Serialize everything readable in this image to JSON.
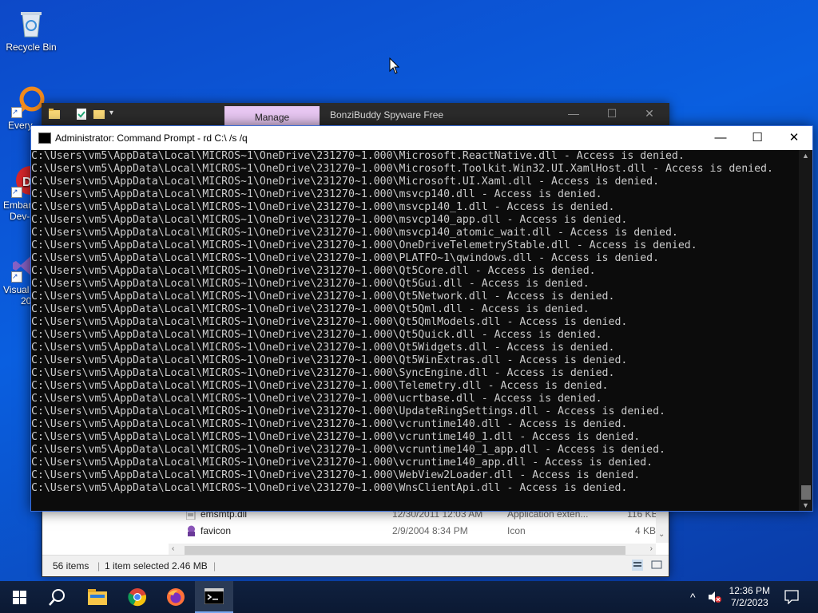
{
  "desktop": {
    "icons": [
      {
        "label": "Recycle Bin"
      },
      {
        "label": "Every"
      },
      {
        "label": "Embar"
      },
      {
        "label": "Dev-"
      },
      {
        "label": "Visual"
      },
      {
        "label": "20"
      }
    ]
  },
  "explorer": {
    "ribbon_tab": "Manage",
    "title": "BonziBuddy Spyware Free",
    "controls": {
      "minimize": "—",
      "maximize": "☐",
      "close": "✕"
    },
    "rows": [
      {
        "name": "emsmtp.dll",
        "date": "12/30/2011 12:03 AM",
        "type": "Application exten...",
        "size": "116 KB"
      },
      {
        "name": "favicon",
        "date": "2/9/2004 8:34 PM",
        "type": "Icon",
        "size": "4 KB"
      }
    ],
    "status": {
      "items": "56 items",
      "selected": "1 item selected  2.46 MB"
    }
  },
  "cmd": {
    "title": "Administrator: Command Prompt - rd  C:\\ /s /q",
    "controls": {
      "minimize": "—",
      "maximize": "☐",
      "close": "✕"
    },
    "lines": [
      "C:\\Users\\vm5\\AppData\\Local\\MICROS~1\\OneDrive\\231270~1.000\\Microsoft.ReactNative.dll - Access is denied.",
      "C:\\Users\\vm5\\AppData\\Local\\MICROS~1\\OneDrive\\231270~1.000\\Microsoft.Toolkit.Win32.UI.XamlHost.dll - Access is denied.",
      "C:\\Users\\vm5\\AppData\\Local\\MICROS~1\\OneDrive\\231270~1.000\\Microsoft.UI.Xaml.dll - Access is denied.",
      "C:\\Users\\vm5\\AppData\\Local\\MICROS~1\\OneDrive\\231270~1.000\\msvcp140.dll - Access is denied.",
      "C:\\Users\\vm5\\AppData\\Local\\MICROS~1\\OneDrive\\231270~1.000\\msvcp140_1.dll - Access is denied.",
      "C:\\Users\\vm5\\AppData\\Local\\MICROS~1\\OneDrive\\231270~1.000\\msvcp140_app.dll - Access is denied.",
      "C:\\Users\\vm5\\AppData\\Local\\MICROS~1\\OneDrive\\231270~1.000\\msvcp140_atomic_wait.dll - Access is denied.",
      "C:\\Users\\vm5\\AppData\\Local\\MICROS~1\\OneDrive\\231270~1.000\\OneDriveTelemetryStable.dll - Access is denied.",
      "C:\\Users\\vm5\\AppData\\Local\\MICROS~1\\OneDrive\\231270~1.000\\PLATFO~1\\qwindows.dll - Access is denied.",
      "C:\\Users\\vm5\\AppData\\Local\\MICROS~1\\OneDrive\\231270~1.000\\Qt5Core.dll - Access is denied.",
      "C:\\Users\\vm5\\AppData\\Local\\MICROS~1\\OneDrive\\231270~1.000\\Qt5Gui.dll - Access is denied.",
      "C:\\Users\\vm5\\AppData\\Local\\MICROS~1\\OneDrive\\231270~1.000\\Qt5Network.dll - Access is denied.",
      "C:\\Users\\vm5\\AppData\\Local\\MICROS~1\\OneDrive\\231270~1.000\\Qt5Qml.dll - Access is denied.",
      "C:\\Users\\vm5\\AppData\\Local\\MICROS~1\\OneDrive\\231270~1.000\\Qt5QmlModels.dll - Access is denied.",
      "C:\\Users\\vm5\\AppData\\Local\\MICROS~1\\OneDrive\\231270~1.000\\Qt5Quick.dll - Access is denied.",
      "C:\\Users\\vm5\\AppData\\Local\\MICROS~1\\OneDrive\\231270~1.000\\Qt5Widgets.dll - Access is denied.",
      "C:\\Users\\vm5\\AppData\\Local\\MICROS~1\\OneDrive\\231270~1.000\\Qt5WinExtras.dll - Access is denied.",
      "C:\\Users\\vm5\\AppData\\Local\\MICROS~1\\OneDrive\\231270~1.000\\SyncEngine.dll - Access is denied.",
      "C:\\Users\\vm5\\AppData\\Local\\MICROS~1\\OneDrive\\231270~1.000\\Telemetry.dll - Access is denied.",
      "C:\\Users\\vm5\\AppData\\Local\\MICROS~1\\OneDrive\\231270~1.000\\ucrtbase.dll - Access is denied.",
      "C:\\Users\\vm5\\AppData\\Local\\MICROS~1\\OneDrive\\231270~1.000\\UpdateRingSettings.dll - Access is denied.",
      "C:\\Users\\vm5\\AppData\\Local\\MICROS~1\\OneDrive\\231270~1.000\\vcruntime140.dll - Access is denied.",
      "C:\\Users\\vm5\\AppData\\Local\\MICROS~1\\OneDrive\\231270~1.000\\vcruntime140_1.dll - Access is denied.",
      "C:\\Users\\vm5\\AppData\\Local\\MICROS~1\\OneDrive\\231270~1.000\\vcruntime140_1_app.dll - Access is denied.",
      "C:\\Users\\vm5\\AppData\\Local\\MICROS~1\\OneDrive\\231270~1.000\\vcruntime140_app.dll - Access is denied.",
      "C:\\Users\\vm5\\AppData\\Local\\MICROS~1\\OneDrive\\231270~1.000\\WebView2Loader.dll - Access is denied.",
      "C:\\Users\\vm5\\AppData\\Local\\MICROS~1\\OneDrive\\231270~1.000\\WnsClientApi.dll - Access is denied."
    ]
  },
  "taskbar": {
    "clock": {
      "time": "12:36 PM",
      "date": "7/2/2023"
    },
    "tray_chevron": "^"
  },
  "colors": {
    "desktop": "#0a5fe0",
    "console_bg": "#0c0c0c",
    "console_fg": "#cccccc",
    "manage_tab": "#e8c7f2"
  }
}
